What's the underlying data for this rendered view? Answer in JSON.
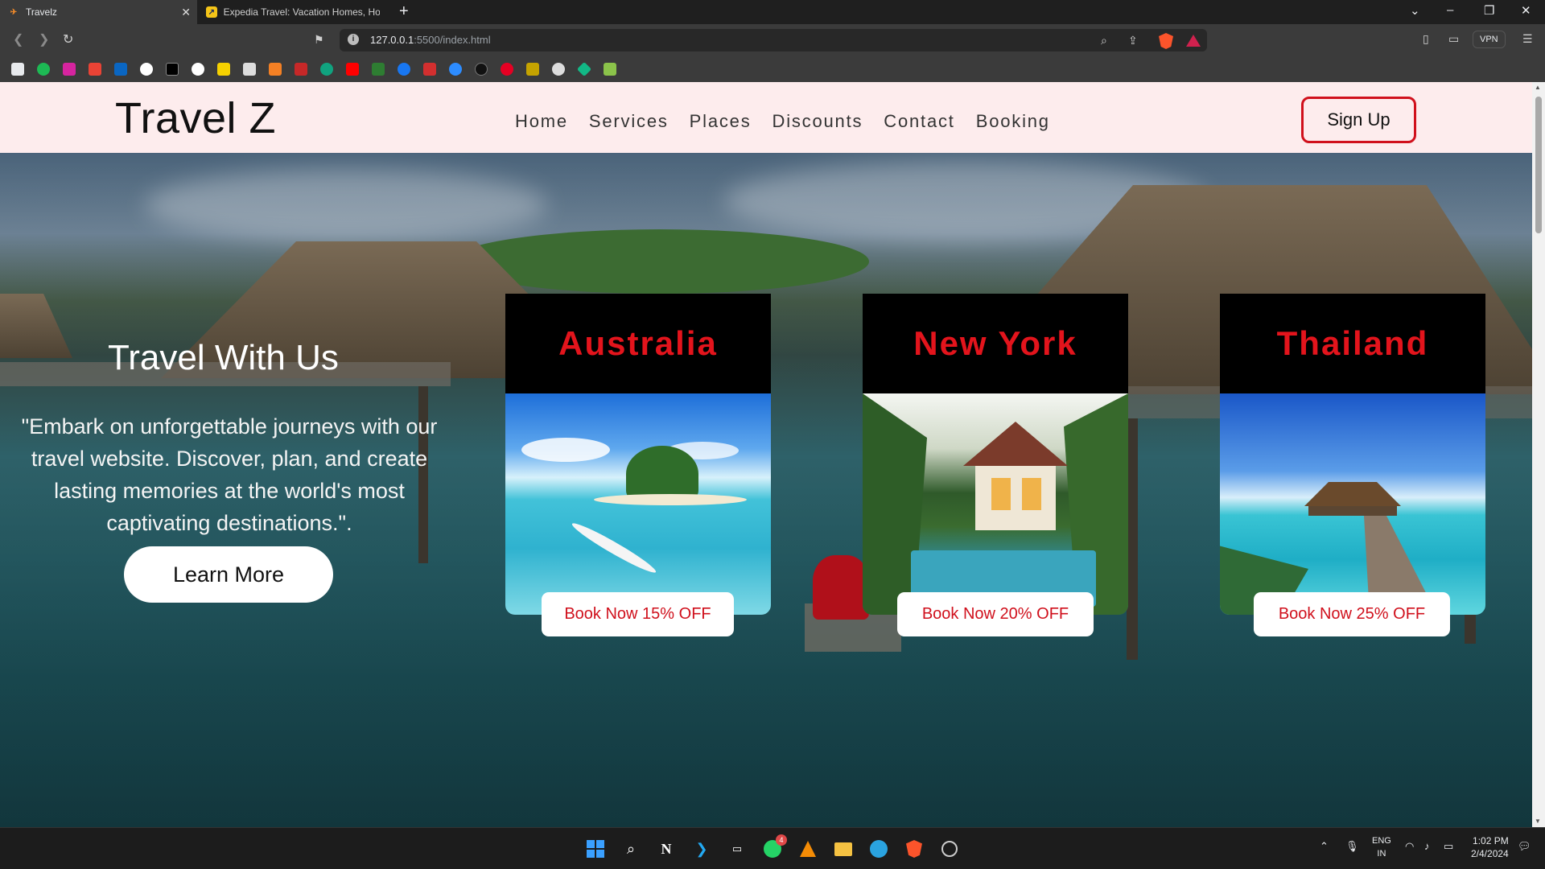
{
  "browser": {
    "tabs": [
      {
        "title": "Travelz",
        "active": true
      },
      {
        "title": "Expedia Travel: Vacation Homes, Hote",
        "active": false
      }
    ],
    "url_host": "127.0.0.1",
    "url_path": ":5500/index.html",
    "vpn_label": "VPN"
  },
  "site": {
    "logo": "Travel Z",
    "nav": [
      "Home",
      "Services",
      "Places",
      "Discounts",
      "Contact",
      "Booking"
    ],
    "signup_label": "Sign Up",
    "hero_title": "Travel With Us",
    "hero_text": "\"Embark on unforgettable journeys with our travel website. Discover, plan, and create lasting memories at the world's most captivating destinations.\".",
    "learn_more_label": "Learn More",
    "cards": [
      {
        "title": "Australia",
        "button": "Book Now 15% OFF"
      },
      {
        "title": "New York",
        "button": "Book Now 20% OFF"
      },
      {
        "title": "Thailand",
        "button": "Book Now 25% OFF"
      }
    ],
    "accent_color": "#e3141c"
  },
  "taskbar": {
    "language": "ENG",
    "region": "IN",
    "time": "1:02 PM",
    "date": "2/4/2024",
    "whatsapp_badge": "4"
  }
}
